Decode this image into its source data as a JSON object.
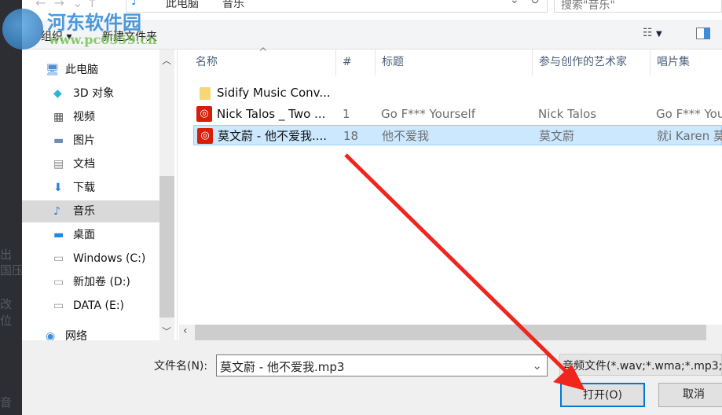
{
  "background_app": {
    "fragments": [
      "出",
      "国压缩",
      "改",
      "位",
      "音"
    ]
  },
  "address": {
    "path": [
      "此电脑",
      "音乐"
    ],
    "search_placeholder": "搜索\"音乐\""
  },
  "watermark": {
    "name": "河东软件园",
    "url": "www.pc0359.cn"
  },
  "toolbar": {
    "organize": "组织",
    "new_folder": "新建文件夹"
  },
  "nav": {
    "items": [
      {
        "label": "此电脑",
        "icon": "computer-icon"
      },
      {
        "label": "3D 对象",
        "icon": "cube-icon"
      },
      {
        "label": "视频",
        "icon": "film-icon"
      },
      {
        "label": "图片",
        "icon": "picture-icon"
      },
      {
        "label": "文档",
        "icon": "document-icon"
      },
      {
        "label": "下载",
        "icon": "download-icon"
      },
      {
        "label": "音乐",
        "icon": "music-icon",
        "selected": true
      },
      {
        "label": "桌面",
        "icon": "desktop-icon"
      },
      {
        "label": "Windows (C:)",
        "icon": "drive-icon"
      },
      {
        "label": "新加卷 (D:)",
        "icon": "drive-icon"
      },
      {
        "label": "DATA (E:)",
        "icon": "drive-icon"
      },
      {
        "label": "网络",
        "icon": "network-icon"
      }
    ]
  },
  "columns": [
    "名称",
    "#",
    "标题",
    "参与创作的艺术家",
    "唱片集"
  ],
  "files": [
    {
      "name": "Sidify Music Conv...",
      "num": "",
      "title": "",
      "artist": "",
      "album": "",
      "type": "folder"
    },
    {
      "name": "Nick Talos _ Two ...",
      "num": "1",
      "title": "Go F*** Yourself",
      "artist": "Nick Talos",
      "album": "Go F*** You",
      "type": "netease"
    },
    {
      "name": "莫文蔚 - 他不爱我....",
      "num": "18",
      "title": "他不爱我",
      "artist": "莫文蔚",
      "album": "就i Karen 莫",
      "type": "netease",
      "selected": true
    }
  ],
  "footer": {
    "filename_label": "文件名(N):",
    "filename_value": "莫文蔚 - 他不爱我.mp3",
    "filter": "音频文件(*.wav;*.wma;*.mp3;",
    "open": "打开(O)",
    "cancel": "取消"
  },
  "colors": {
    "selection": "#cce8ff",
    "accent": "#0078d7",
    "arrow": "#f0261e"
  }
}
